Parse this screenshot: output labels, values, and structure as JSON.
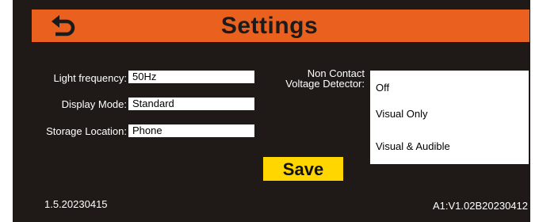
{
  "header": {
    "title": "Settings",
    "back_icon": "back-arrow-icon"
  },
  "settings": {
    "light_frequency": {
      "label": "Light frequency:",
      "value": "50Hz"
    },
    "display_mode": {
      "label": "Display Mode:",
      "value": "Standard"
    },
    "storage_location": {
      "label": "Storage Location:",
      "value": "Phone"
    }
  },
  "ncvd": {
    "label_line1": "Non Contact",
    "label_line2": "Voltage Detector:",
    "options": [
      "Off",
      "Visual Only",
      "Visual & Audible"
    ]
  },
  "save_label": "Save",
  "version_left": "1.5.20230415",
  "version_right": "A1:V1.02B20230412",
  "colors": {
    "header": "#e9601f",
    "background": "#1f1a17",
    "save_button": "#ffd600"
  }
}
